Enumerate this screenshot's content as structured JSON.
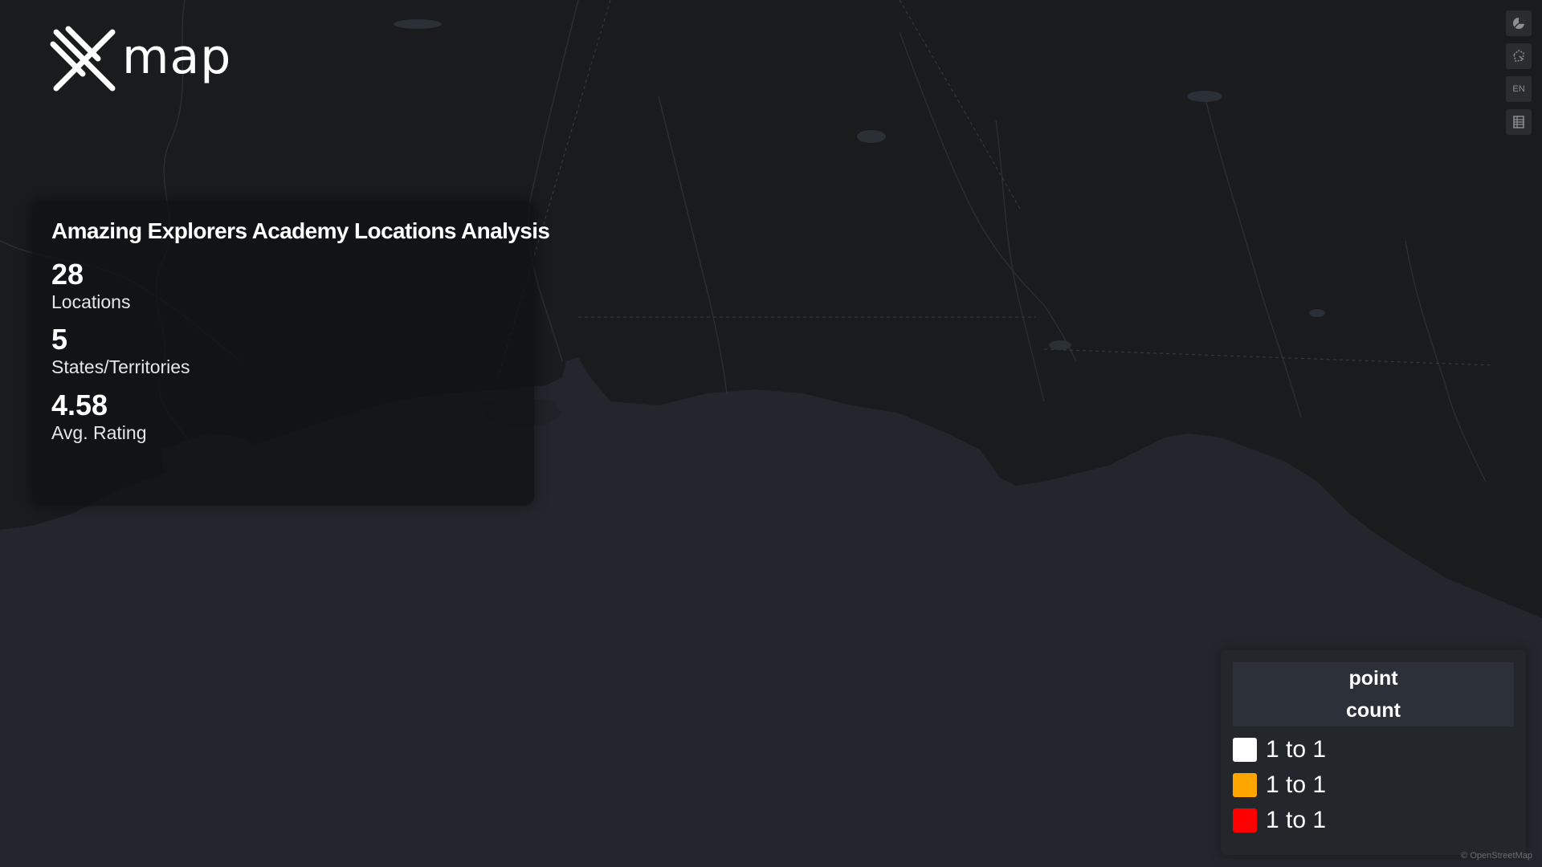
{
  "app": {
    "logo_text": "map"
  },
  "stats": {
    "title": "Amazing Explorers Academy Locations Analysis",
    "items": [
      {
        "value": "28",
        "label": "Locations"
      },
      {
        "value": "5",
        "label": "States/Territories"
      },
      {
        "value": "4.58",
        "label": "Avg. Rating"
      }
    ]
  },
  "controls": {
    "buttons": [
      {
        "icon": "pie-chart-icon",
        "label": ""
      },
      {
        "icon": "polygon-select-icon",
        "label": ""
      },
      {
        "icon": "language-icon",
        "label": "EN"
      },
      {
        "icon": "table-icon",
        "label": ""
      }
    ]
  },
  "legend": {
    "title_line1": "point",
    "title_line2": "count",
    "items": [
      {
        "label": "1 to 1",
        "color": "#ffffff"
      },
      {
        "label": "1 to 1",
        "color": "#ffa500"
      },
      {
        "label": "1 to 1",
        "color": "#ff0000"
      }
    ]
  },
  "map": {
    "land_color": "#1a1b1d",
    "water_color": "#23272d"
  },
  "attribution": "© OpenStreetMap"
}
